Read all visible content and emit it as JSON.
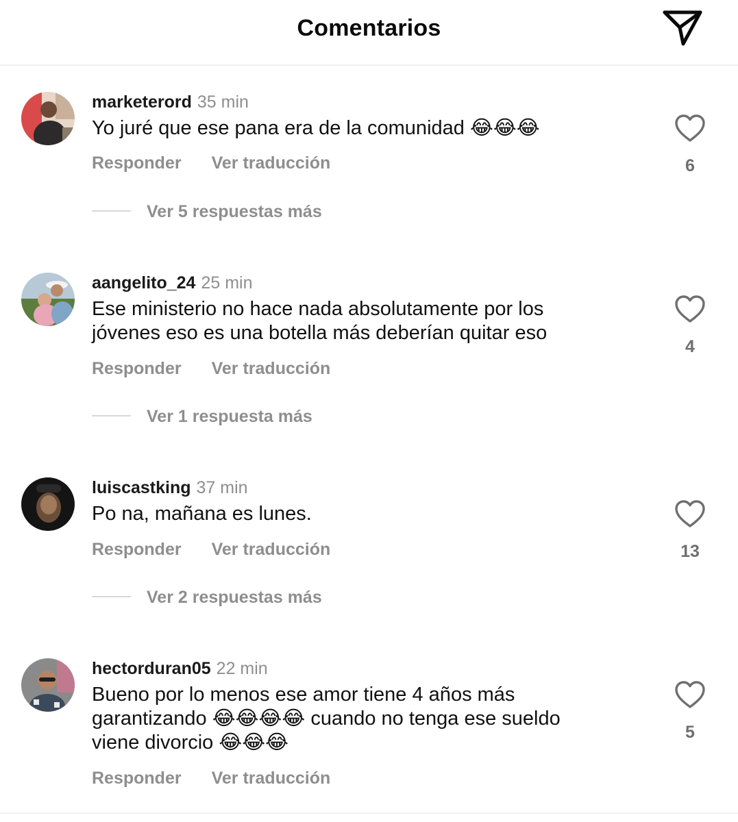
{
  "header": {
    "title": "Comentarios",
    "share_icon": "paper-plane-icon"
  },
  "comments": [
    {
      "username": "marketerord",
      "time": "35 min",
      "text": "Yo juré que ese pana era de la comunidad 😂😂😂",
      "reply_label": "Responder",
      "translate_label": "Ver traducción",
      "replies_label": "Ver 5 respuestas más",
      "likes": "6"
    },
    {
      "username": "aangelito_24",
      "time": "25 min",
      "text": "Ese ministerio no hace nada absolutamente por los\njóvenes eso es una botella más deberían quitar eso",
      "reply_label": "Responder",
      "translate_label": "Ver traducción",
      "replies_label": "Ver 1 respuesta más",
      "likes": "4"
    },
    {
      "username": "luiscastking",
      "time": "37 min",
      "text": "Po na, mañana es lunes.",
      "reply_label": "Responder",
      "translate_label": "Ver traducción",
      "replies_label": "Ver 2 respuestas más",
      "likes": "13"
    },
    {
      "username": "hectorduran05",
      "time": "22 min",
      "text": "Bueno por lo menos ese amor tiene 4 años más\ngarantizando 😂😂😂😂 cuando no tenga ese sueldo\nviene divorcio 😂😂😂",
      "reply_label": "Responder",
      "translate_label": "Ver traducción",
      "likes": "5"
    }
  ],
  "colors": {
    "secondary_text": "#8e8e8e",
    "primary_text": "#0a0a0a",
    "divider": "#efefef"
  }
}
